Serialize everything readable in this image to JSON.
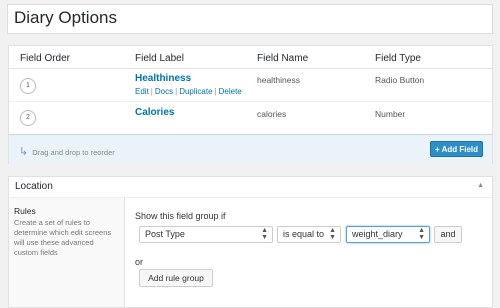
{
  "title": "Diary Options",
  "fields_table": {
    "headers": {
      "order": "Field Order",
      "label": "Field Label",
      "name": "Field Name",
      "type": "Field Type"
    },
    "rows": [
      {
        "order": "1",
        "label": "Healthiness",
        "name": "healthiness",
        "type": "Radio Button",
        "actions": [
          "Edit",
          "Docs",
          "Duplicate",
          "Delete"
        ]
      },
      {
        "order": "2",
        "label": "Calories",
        "name": "calories",
        "type": "Number"
      }
    ],
    "drag_hint": "Drag and drop to reorder",
    "add_field": "+ Add Field"
  },
  "location": {
    "title": "Location",
    "rules_title": "Rules",
    "rules_desc": "Create a set of rules to determine which edit screens will use these advanced custom fields",
    "show_if": "Show this field group if",
    "param": "Post Type",
    "operator": "is equal to",
    "value": "weight_diary",
    "and_label": "and",
    "or_label": "or",
    "add_rule_group": "Add rule group"
  }
}
